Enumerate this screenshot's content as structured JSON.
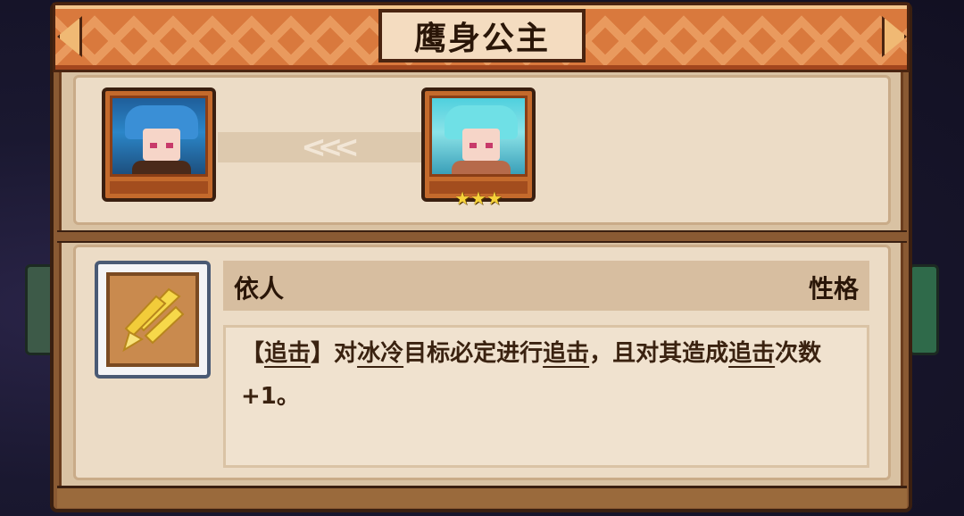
{
  "title": "鹰身公主",
  "evolution": {
    "from_portrait": "harpy-princess-base-portrait",
    "to_portrait": "harpy-princess-evolved-portrait",
    "arrow_glyph": "<<<",
    "stars": "★★★"
  },
  "trait": {
    "icon": "yellow-strike-icon",
    "name": "依人",
    "type": "性格",
    "desc": {
      "open_bracket": "【",
      "kw1": "追击",
      "close_bracket": "】",
      "t1": "对",
      "kw2": "冰冷",
      "t2": "目标必定进行",
      "kw3": "追击",
      "t3": "，且对其造成",
      "kw4": "追击",
      "t4": "次数+1。"
    }
  },
  "colors": {
    "banner": "#d9793d",
    "panel": "#8a5a33",
    "parchment": "#ecdcc6",
    "text": "#2a1608",
    "star": "#f6d23a"
  }
}
